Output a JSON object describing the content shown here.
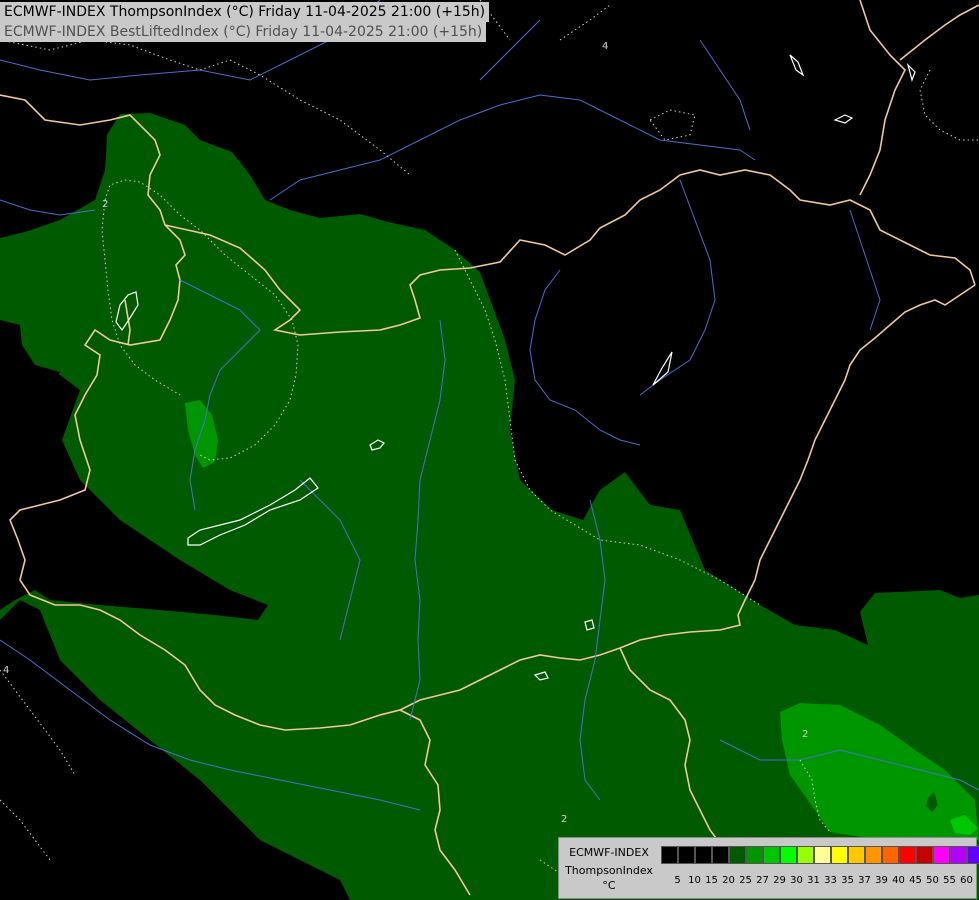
{
  "titles": {
    "line1": "ECMWF-INDEX ThompsonIndex (°C) Friday 11-04-2025 21:00 (+15h)",
    "line2": "ECMWF-INDEX BestLiftedIndex (°C) Friday 11-04-2025 21:00 (+15h)"
  },
  "map": {
    "fill_colors": {
      "dark_green": "#005a00",
      "mid_green": "#009600",
      "light_green": "#00c800"
    },
    "border_color": "#f0c89a",
    "river_color": "#4a6fcf",
    "contour_labels": [
      "4",
      "2",
      "4",
      "2",
      "2"
    ]
  },
  "legend": {
    "line1": "ECMWF-INDEX",
    "line2": "ThompsonIndex",
    "line3": "°C",
    "ticks": [
      "5",
      "10",
      "15",
      "20",
      "25",
      "27",
      "29",
      "30",
      "31",
      "33",
      "35",
      "37",
      "39",
      "40",
      "45",
      "50",
      "55",
      "60"
    ],
    "colors": [
      "#000000",
      "#000000",
      "#000000",
      "#000000",
      "#005a00",
      "#009600",
      "#00c800",
      "#00ff00",
      "#96ff00",
      "#ffff96",
      "#ffff00",
      "#ffc800",
      "#ff9600",
      "#ff6400",
      "#ff0000",
      "#c80000",
      "#ff00ff",
      "#b400ff",
      "#6400ff",
      "#0000ff"
    ]
  }
}
